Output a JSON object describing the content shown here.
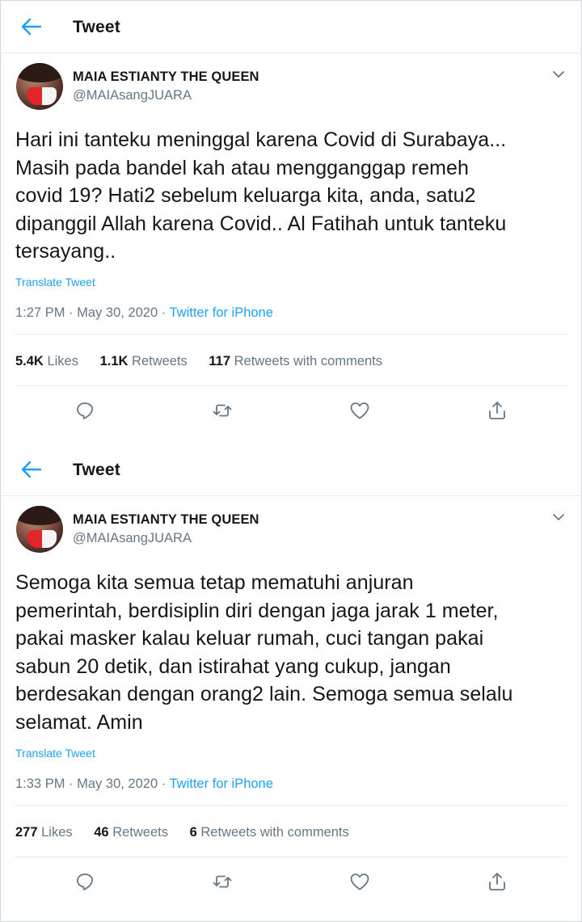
{
  "colors": {
    "accent": "#1da1f2",
    "text": "#14171a",
    "muted": "#657786",
    "border": "#e6ecf0"
  },
  "panels": [
    {
      "header": {
        "back_icon": "arrow-left-icon",
        "title": "Tweet"
      },
      "tweet": {
        "author_name": "MAIA ESTIANTY THE QUEEN",
        "handle": "@MAIAsangJUARA",
        "lines": [
          "Hari ini tanteku meninggal karena Covid di Surabaya...",
          "Masih pada bandel kah atau mengganggap remeh",
          "covid 19? Hati2  sebelum keluarga kita, anda,  satu2",
          "dipanggil Allah karena Covid.. Al Fatihah untuk tanteku",
          "tersayang.."
        ],
        "translate_label": "Translate Tweet",
        "time": "1:27 PM",
        "date": "May 30, 2020",
        "separator": "·",
        "source": "Twitter for iPhone",
        "likes_count": "5.4K",
        "likes_label": "Likes",
        "retweets_count": "1.1K",
        "retweets_label": "Retweets",
        "quotes_count": "117",
        "quotes_label": "Retweets with comments"
      }
    },
    {
      "header": {
        "back_icon": "arrow-left-icon",
        "title": "Tweet"
      },
      "tweet": {
        "author_name": "MAIA ESTIANTY THE QUEEN",
        "handle": "@MAIAsangJUARA",
        "lines": [
          "Semoga kita semua tetap mematuhi anjuran",
          "pemerintah, berdisiplin diri dengan jaga jarak 1 meter,",
          "pakai masker kalau keluar rumah, cuci tangan pakai",
          "sabun 20 detik, dan istirahat yang cukup, jangan",
          "berdesakan dengan orang2 lain. Semoga semua selalu",
          "selamat. Amin"
        ],
        "translate_label": "Translate Tweet",
        "time": "1:33 PM",
        "date": "May 30, 2020",
        "separator": "·",
        "source": "Twitter for iPhone",
        "likes_count": "277",
        "likes_label": "Likes",
        "retweets_count": "46",
        "retweets_label": "Retweets",
        "quotes_count": "6",
        "quotes_label": "Retweets with comments"
      }
    }
  ],
  "actions": [
    {
      "icon": "reply-icon"
    },
    {
      "icon": "retweet-icon"
    },
    {
      "icon": "like-icon"
    },
    {
      "icon": "share-icon"
    }
  ]
}
